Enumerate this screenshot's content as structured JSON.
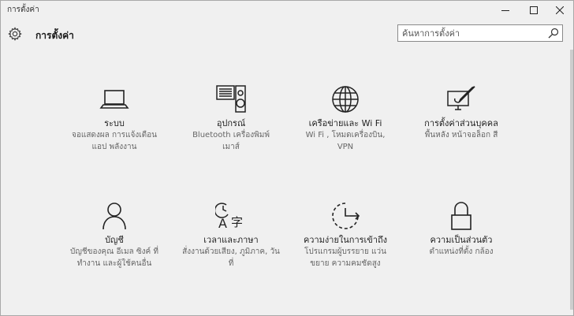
{
  "window": {
    "title": "การตั้งค่า"
  },
  "header": {
    "title": "การตั้งค่า"
  },
  "search": {
    "placeholder": "ค้นหาการตั้งค่า"
  },
  "tiles": [
    {
      "title": "ระบบ",
      "desc": [
        "จอแสดงผล การแจ้งเตือน",
        "แอป พลังงาน"
      ],
      "icon": "laptop-icon"
    },
    {
      "title": "อุปกรณ์",
      "desc": [
        "Bluetooth เครื่องพิมพ์",
        "เมาส์"
      ],
      "icon": "devices-icon"
    },
    {
      "title": "เครือข่ายและ Wi Fi",
      "desc": [
        "Wi Fi , โหมดเครื่องบิน,",
        "VPN"
      ],
      "icon": "globe-icon"
    },
    {
      "title": "การตั้งค่าส่วนบุคคล",
      "desc": [
        "พื้นหลัง หน้าจอล็อก สี"
      ],
      "icon": "personalization-icon"
    },
    {
      "title": "บัญชี",
      "desc": [
        "บัญชีของคุณ อีเมล ซิงค์ ที่",
        "ทำงาน และผู้ใช้คนอื่น"
      ],
      "icon": "person-icon"
    },
    {
      "title": "เวลาและภาษา",
      "desc": [
        "สั่งงานด้วยเสียง, ภูมิภาค, วัน",
        "ที่"
      ],
      "icon": "time-language-icon"
    },
    {
      "title": "ความง่ายในการเข้าถึง",
      "desc": [
        "โปรแกรมผู้บรรยาย แว่น",
        "ขยาย ความคมชัดสูง"
      ],
      "icon": "ease-of-access-icon"
    },
    {
      "title": "ความเป็นส่วนตัว",
      "desc": [
        "ตำแหน่งที่ตั้ง กล้อง"
      ],
      "icon": "lock-icon"
    }
  ]
}
